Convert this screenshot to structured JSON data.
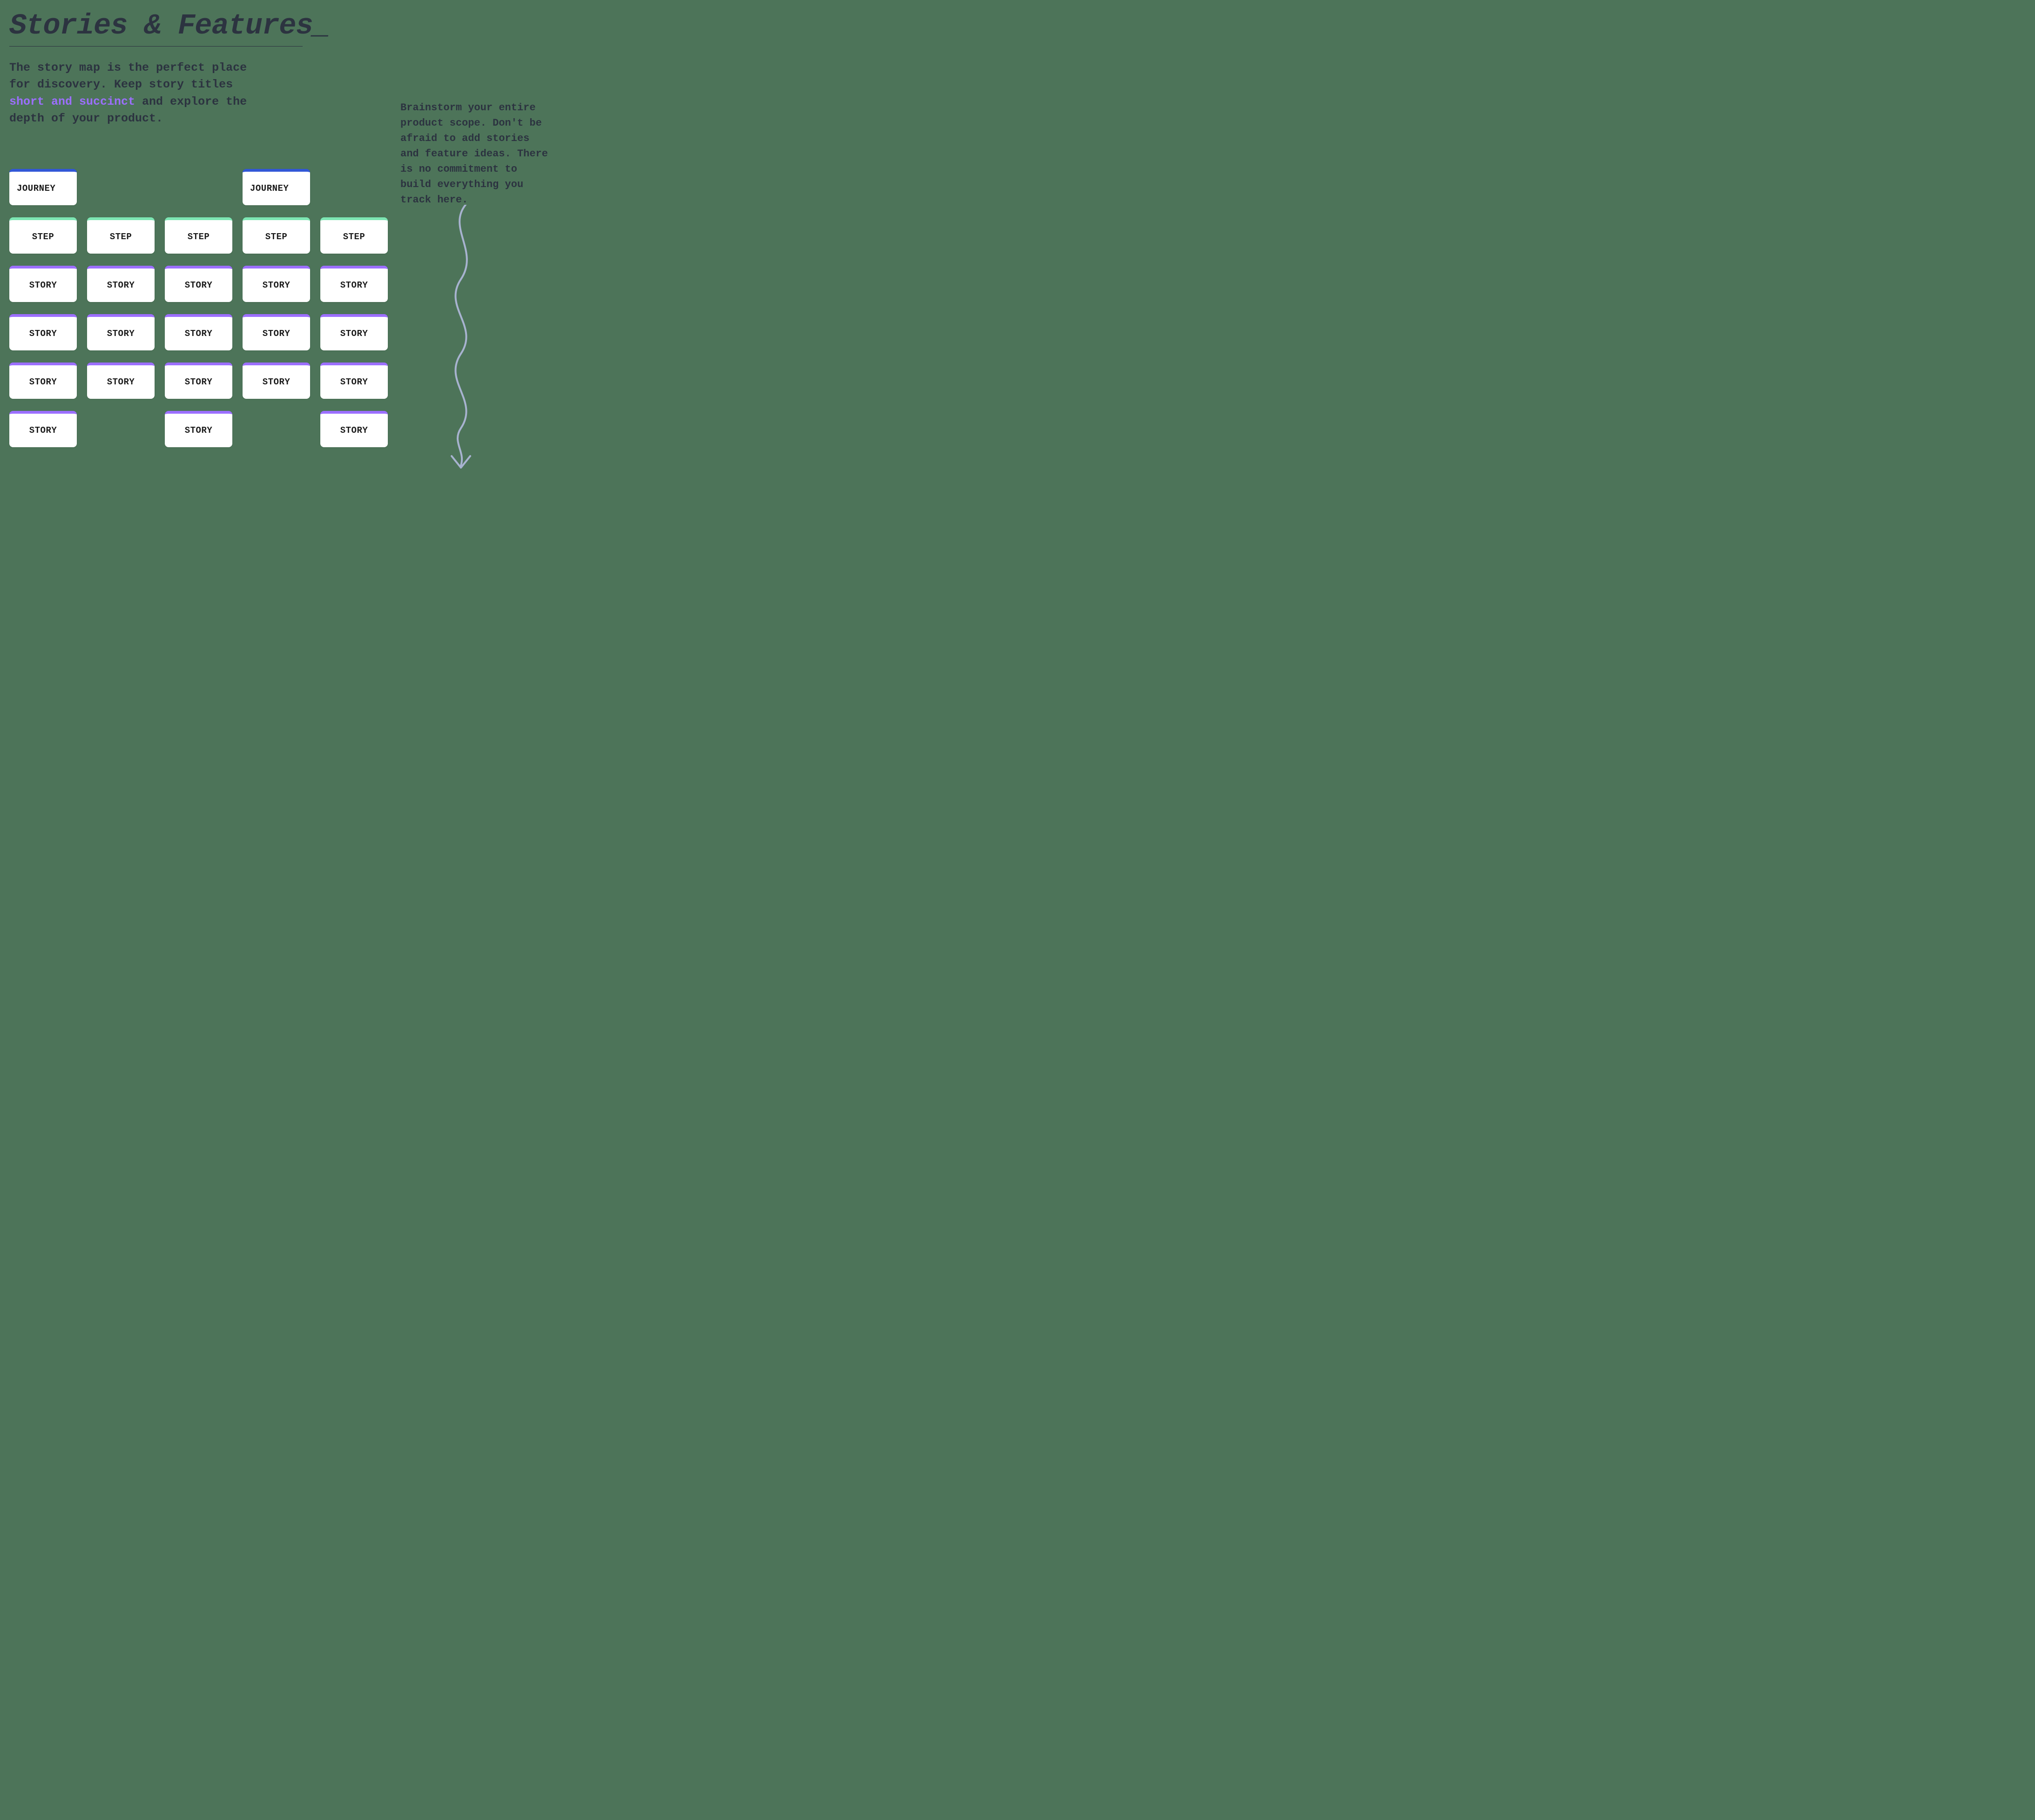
{
  "heading": "Stories & Features_",
  "intro": {
    "pre": "The story map is the perfect place for discovery. Keep story titles ",
    "highlight": "short and succinct",
    "post": " and explore the depth of your product."
  },
  "sideNote": "Brainstorm your entire product scope. Don't be afraid to add stories and feature ideas. There is no commitment to build everything you track here.",
  "labels": {
    "journey": "JOURNEY",
    "step": "STEP",
    "story": "STORY"
  },
  "columns": [
    [
      "journey",
      "step",
      "story",
      "story",
      "story",
      "story"
    ],
    [
      "spacer",
      "step",
      "story",
      "story",
      "story",
      "spacer"
    ],
    [
      "spacer",
      "step",
      "story",
      "story",
      "story",
      "story"
    ],
    [
      "journey",
      "step",
      "story",
      "story",
      "story",
      "spacer"
    ],
    [
      "spacer",
      "step",
      "story",
      "story",
      "story",
      "story"
    ]
  ]
}
